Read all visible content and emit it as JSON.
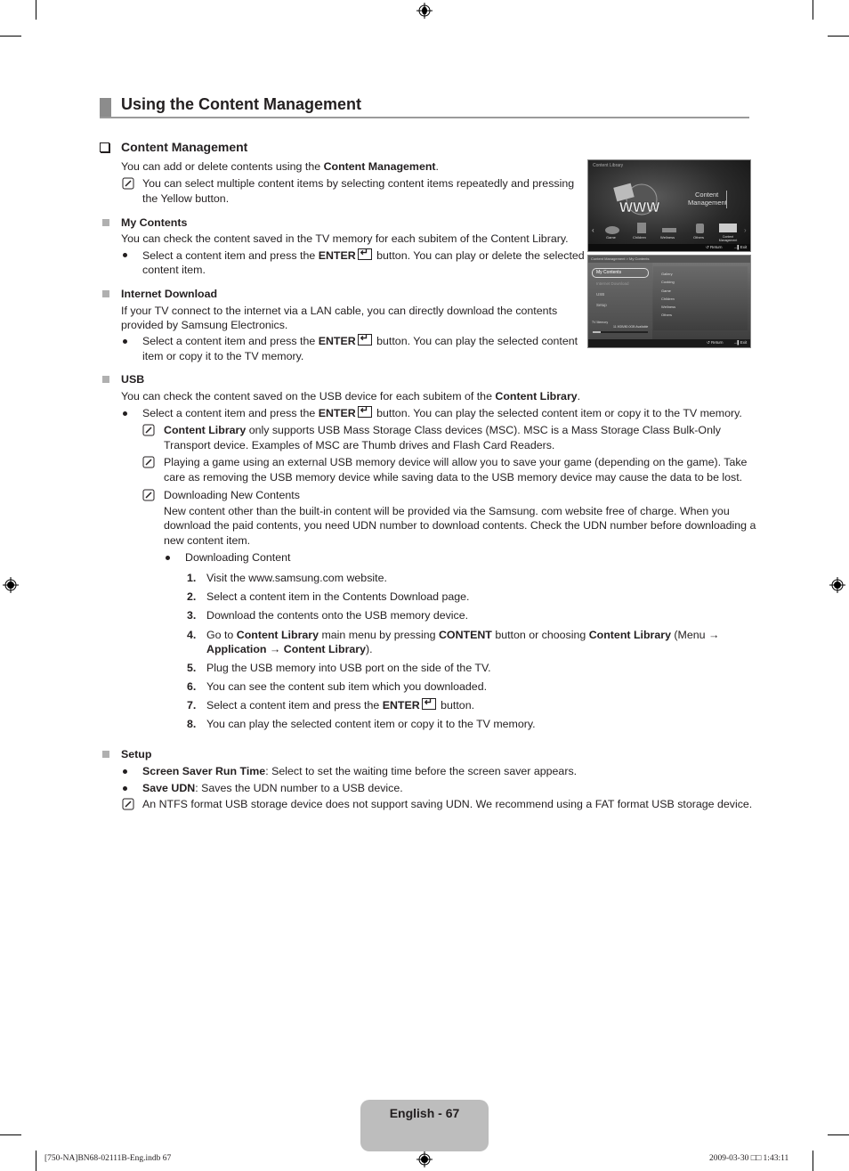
{
  "page": {
    "section_title": "Using the Content Management",
    "subsection_title": "Content Management",
    "intro": {
      "pre": "You can add or delete contents using the ",
      "bold": "Content Management",
      "post": "."
    },
    "intro_note": [
      "You can select multiple content items by selecting content items repeatedly and pressing",
      "the Yellow button."
    ],
    "my_contents": {
      "title": "My Contents",
      "desc": "You can check the content saved in the TV memory for each subitem of the Content Library.",
      "bullet": {
        "pre": "Select a content item and press the ",
        "bold": "ENTER",
        "post": " button. You can play or delete the selected",
        "line2": "content item."
      }
    },
    "internet_download": {
      "title": "Internet Download",
      "desc": [
        "If your TV connect to the internet via a LAN cable, you can directly download the contents",
        "provided by Samsung Electronics."
      ],
      "bullet": {
        "pre": "Select a content item and press the ",
        "bold": "ENTER",
        "post": " button. You can play the selected content",
        "line2": "item or copy it to the TV memory."
      }
    },
    "usb": {
      "title": "USB",
      "desc": {
        "pre": "You can check the content saved on the USB device for each subitem of the ",
        "bold": "Content Library",
        "post": "."
      },
      "bullet": {
        "pre": "Select a content item and press the ",
        "bold": "ENTER",
        "post": " button. You can play the selected content item or copy it to the TV memory."
      },
      "note1": {
        "bold": "Content Library",
        "post": " only supports USB Mass Storage Class devices (MSC). MSC is a Mass Storage Class Bulk-Only",
        "line2": "Transport device. Examples of MSC are Thumb drives and Flash Card Readers."
      },
      "note2": [
        "Playing a game using an external USB memory device will allow you to save your game (depending on the game). Take",
        "care as removing the USB memory device while saving data to the USB memory device may cause the data to be lost."
      ],
      "note3": {
        "title": "Downloading New Contents",
        "desc": [
          "New content other than the built-in content will be provided via the Samsung. com website free of charge. When you",
          "download the paid contents, you need UDN number to download contents. Check the UDN number before downloading a",
          "new content item."
        ],
        "bullet": "Downloading Content",
        "steps": [
          {
            "n": "1.",
            "text": "Visit the www.samsung.com website."
          },
          {
            "n": "2.",
            "text": "Select a content item in the Contents Download page."
          },
          {
            "n": "3.",
            "text": "Download the contents onto the USB memory device."
          },
          {
            "n": "4.",
            "a": "Go to ",
            "b": "Content Library",
            "c": " main menu by pressing ",
            "d": "CONTENT",
            "e": " button or choosing ",
            "f": "Content Library",
            "g": " (Menu →",
            "h": "Application",
            "i": " → ",
            "j": "Content Library",
            "k": ")."
          },
          {
            "n": "5.",
            "text": "Plug the USB memory into USB port on the side of the TV."
          },
          {
            "n": "6.",
            "text": "You can see the content sub item which you downloaded."
          },
          {
            "n": "7.",
            "pre": "Select a content item and press the ",
            "bold": "ENTER",
            "post": " button."
          },
          {
            "n": "8.",
            "text": "You can play the selected content item or copy it to the TV memory."
          }
        ]
      }
    },
    "setup": {
      "title": "Setup",
      "bullet1": {
        "bold": "Screen Saver Run Time",
        "post": ": Select to set the waiting time before the screen saver appears."
      },
      "bullet2": {
        "bold": "Save UDN",
        "post": ": Saves the UDN number to a USB device."
      },
      "note": "An NTFS format USB storage device does not support saving UDN. We recommend using a FAT format USB storage device."
    },
    "footer": {
      "label": "English - 67"
    },
    "slug": {
      "left": "[750-NA]BN68-02111B-Eng.indb   67",
      "right": "2009-03-30   □□ 1:43:11"
    }
  },
  "tv1": {
    "header": "Content Library",
    "center_label": [
      "Content",
      "Management"
    ],
    "categories": [
      "Game",
      "Children",
      "Wellness",
      "Others",
      "Content Management"
    ],
    "footer": {
      "return": "Return",
      "exit": "Exit"
    }
  },
  "tv2": {
    "header": "Content Management > My Contents",
    "menu": [
      "My Contents",
      "Internet Download",
      "USB",
      "Setup"
    ],
    "memory_label": "TV Memory",
    "memory_value": "11.9GB/80.0GB Available",
    "items": [
      "Gallery",
      "Cooking",
      "Game",
      "Children",
      "Wellness",
      "Others"
    ],
    "footer": {
      "return": "Return",
      "exit": "Exit"
    }
  }
}
